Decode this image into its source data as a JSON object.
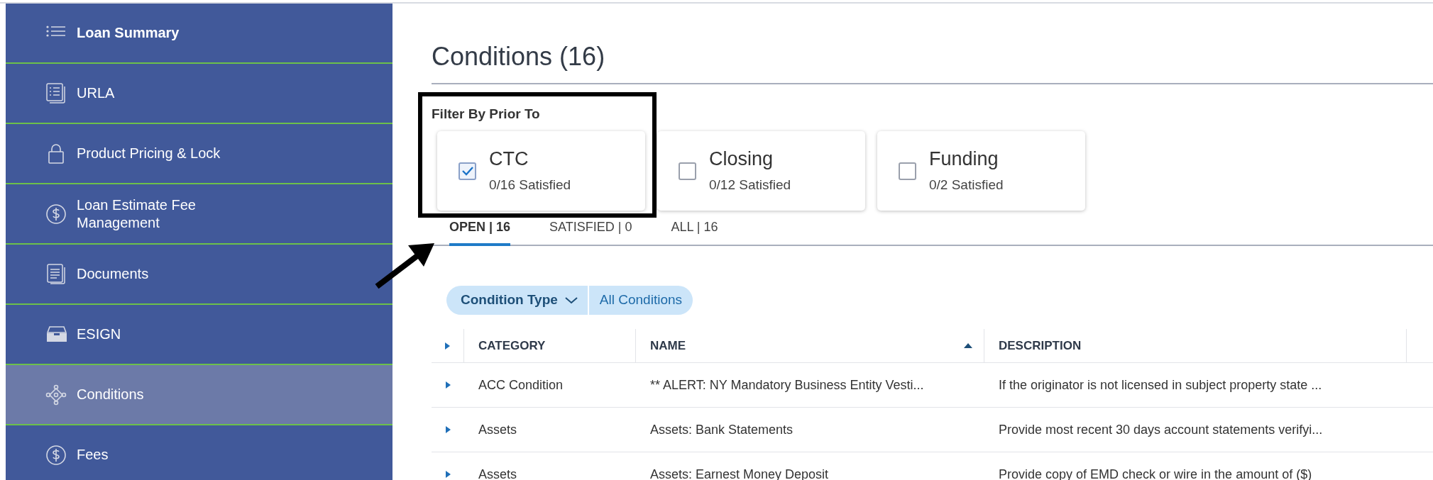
{
  "sidebar": {
    "items": [
      {
        "label": "Loan Summary",
        "kind": "list",
        "selected": false,
        "bold": true
      },
      {
        "label": "URLA",
        "kind": "form",
        "selected": false,
        "bold": false
      },
      {
        "label": "Product Pricing & Lock",
        "kind": "lock",
        "selected": false,
        "bold": false
      },
      {
        "label": "Loan Estimate Fee Management",
        "kind": "dollar",
        "selected": false,
        "bold": false
      },
      {
        "label": "Documents",
        "kind": "document",
        "selected": false,
        "bold": false
      },
      {
        "label": "ESIGN",
        "kind": "tray",
        "selected": false,
        "bold": false
      },
      {
        "label": "Conditions",
        "kind": "network",
        "selected": true,
        "bold": false
      },
      {
        "label": "Fees",
        "kind": "dollar",
        "selected": false,
        "bold": false
      }
    ]
  },
  "page_title": "Conditions (16)",
  "filter": {
    "label": "Filter By Prior To",
    "options": [
      {
        "title": "CTC",
        "subtitle": "0/16 Satisfied",
        "checked": true
      },
      {
        "title": "Closing",
        "subtitle": "0/12 Satisfied",
        "checked": false
      },
      {
        "title": "Funding",
        "subtitle": "0/2 Satisfied",
        "checked": false
      }
    ]
  },
  "tabs": [
    {
      "label": "OPEN | 16",
      "selected": true
    },
    {
      "label": "SATISFIED | 0",
      "selected": false
    },
    {
      "label": "ALL | 16",
      "selected": false
    }
  ],
  "chips": {
    "dropdown": "Condition Type",
    "value": "All Conditions"
  },
  "table": {
    "columns": [
      {
        "label": "CATEGORY",
        "sorted": false
      },
      {
        "label": "NAME",
        "sorted": true
      },
      {
        "label": "DESCRIPTION",
        "sorted": false
      }
    ],
    "rows": [
      [
        "ACC Condition",
        "** ALERT: NY Mandatory Business Entity Vesti...",
        "If the originator is not licensed in subject property state ..."
      ],
      [
        "Assets",
        "Assets: Bank Statements",
        "Provide most recent 30 days account statements verifyi..."
      ],
      [
        "Assets",
        "Assets: Earnest Money Deposit",
        "Provide copy of EMD check or wire in the amount of ($)"
      ]
    ]
  }
}
